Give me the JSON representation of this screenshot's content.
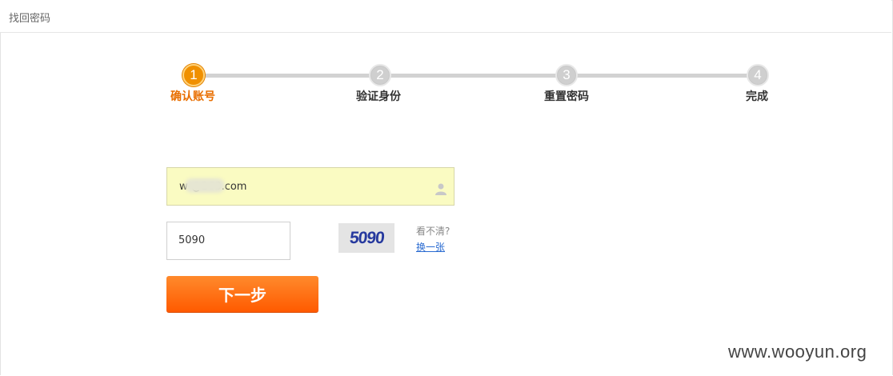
{
  "header": {
    "title": "找回密码"
  },
  "steps": [
    {
      "number": "1",
      "label": "确认账号",
      "state": "active"
    },
    {
      "number": "2",
      "label": "验证身份",
      "state": "inactive"
    },
    {
      "number": "3",
      "label": "重置密码",
      "state": "inactive"
    },
    {
      "number": "4",
      "label": "完成",
      "state": "inactive"
    }
  ],
  "form": {
    "email_value": "w         @163.com",
    "captcha_value": "5090",
    "captcha_image_text": "5090",
    "captcha_hint": "看不清?",
    "captcha_refresh": "换一张",
    "submit_label": "下一步"
  },
  "watermark": "www.wooyun.org",
  "colors": {
    "accent": "#f09000",
    "button": "#ff6a10",
    "field_highlight": "#fafbc2"
  },
  "icons": {
    "email_field": "user-icon"
  }
}
